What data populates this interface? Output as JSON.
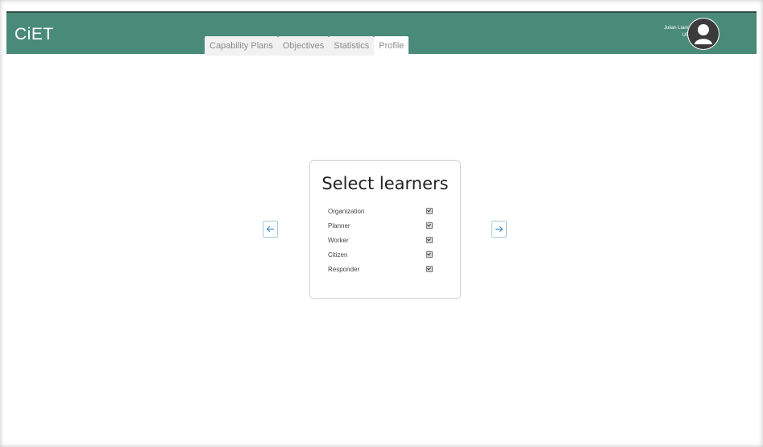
{
  "app": {
    "logo": "CiET"
  },
  "nav": {
    "tabs": [
      {
        "label": "Capability Plans"
      },
      {
        "label": "Objectives"
      },
      {
        "label": "Statistics"
      },
      {
        "label": "Profile",
        "active": true
      }
    ]
  },
  "user": {
    "name": "Julian Llanos",
    "org": "UPV",
    "avatar_icon": "user-silhouette-icon"
  },
  "panel": {
    "title": "Select learners",
    "options": [
      {
        "label": "Organization",
        "checked": true
      },
      {
        "label": "Planner",
        "checked": true
      },
      {
        "label": "Worker",
        "checked": true
      },
      {
        "label": "Citizen",
        "checked": true
      },
      {
        "label": "Responder",
        "checked": true
      }
    ]
  },
  "navigation": {
    "prev_icon": "arrow-left-icon",
    "next_icon": "arrow-right-icon"
  },
  "colors": {
    "header": "#4a8a78",
    "tab_bg": "#f1f1f1",
    "arrow": "#4a90c8"
  }
}
